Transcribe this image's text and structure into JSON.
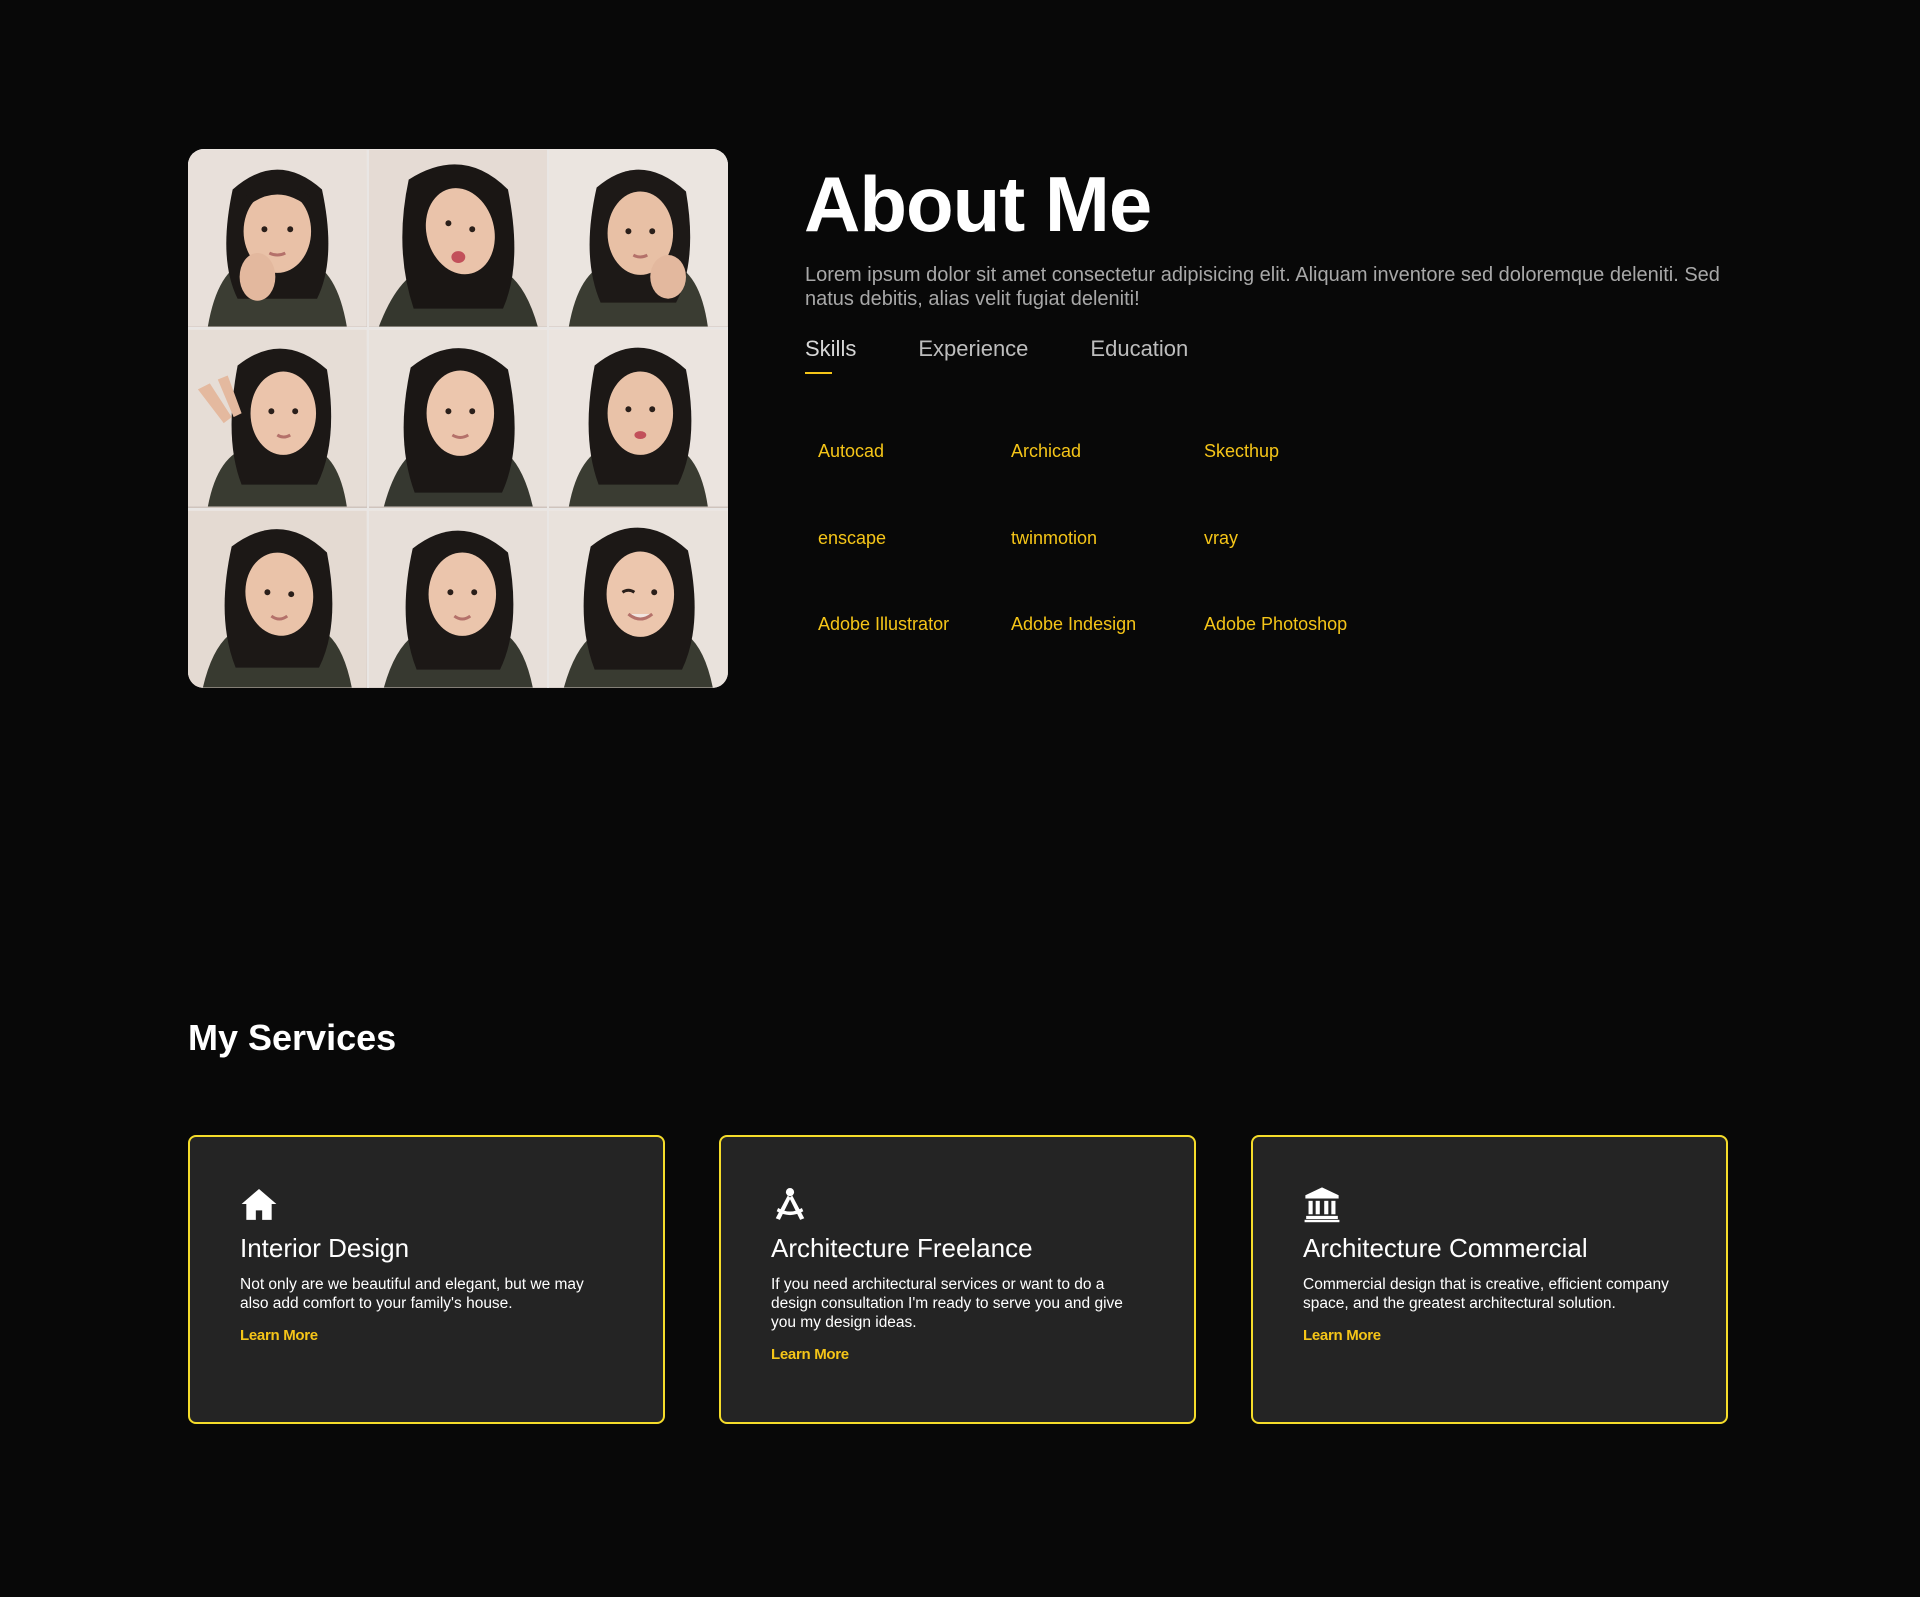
{
  "about": {
    "title": "About Me",
    "description": "Lorem ipsum dolor sit amet consectetur adipisicing elit. Aliquam inventore sed doloremque deleniti. Sed natus debitis, alias velit fugiat deleniti!",
    "tabs": [
      {
        "label": "Skills",
        "active": true
      },
      {
        "label": "Experience",
        "active": false
      },
      {
        "label": "Education",
        "active": false
      }
    ],
    "skills": [
      "Autocad",
      "Archicad",
      "Skecthup",
      "enscape",
      "twinmotion",
      "vray",
      "Adobe Illustrator",
      "Adobe Indesign",
      "Adobe Photoshop"
    ]
  },
  "services": {
    "title": "My Services",
    "cards": [
      {
        "icon": "house-icon",
        "title": "Interior Design",
        "text": "Not only are we beautiful and elegant, but we may also add comfort to your family's house.",
        "link": "Learn More"
      },
      {
        "icon": "drafting-compass-icon",
        "title": "Architecture Freelance",
        "text": "If you need architectural services or want to do a design consultation I'm ready to serve you and give you my design ideas.",
        "link": "Learn More"
      },
      {
        "icon": "landmark-icon",
        "title": "Architecture Commercial",
        "text": "Commercial design that is creative, efficient company space, and the greatest architectural solution.",
        "link": "Learn More"
      }
    ]
  },
  "colors": {
    "background": "#080808",
    "accent": "#f5c518",
    "card_border": "#f5dc2a",
    "card_background": "#242424",
    "muted_text": "#a8a8a8"
  }
}
